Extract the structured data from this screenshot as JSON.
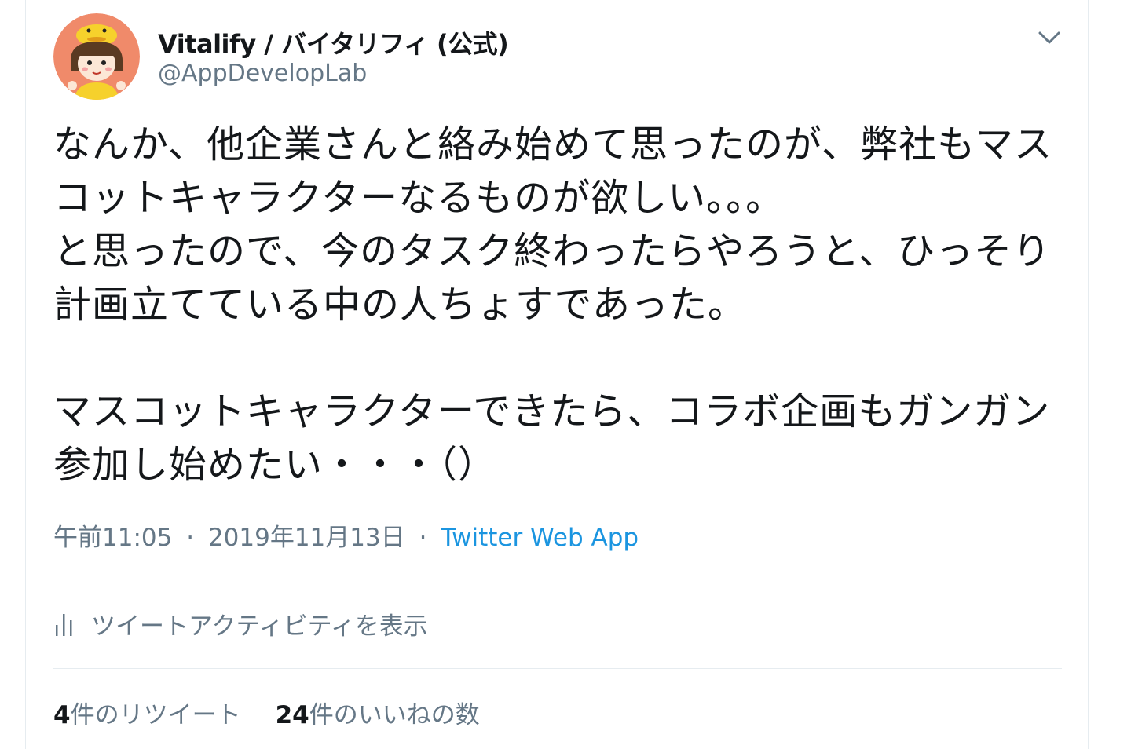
{
  "author": {
    "display_name": "Vitalify / バイタリフィ (公式)",
    "handle": "@AppDevelopLab",
    "avatar_icon": "mascot-avatar-icon"
  },
  "tweet": {
    "paragraph1": "なんか、他企業さんと絡み始めて思ったのが、弊社もマスコットキャラクターなるものが欲しい。。。\nと思ったので、今のタスク終わったらやろうと、ひっそり計画立てている中の人ちょすであった。",
    "paragraph2": "マスコットキャラクターできたら、コラボ企画もガンガン参加し始めたい・・・（）"
  },
  "meta": {
    "time": "午前11:05",
    "separator": "·",
    "date": "2019年11月13日",
    "source": "Twitter Web App"
  },
  "activity": {
    "label": "ツイートアクティビティを表示",
    "icon": "bar-chart-icon"
  },
  "stats": {
    "retweet_count": "4",
    "retweet_label": "件のリツイート",
    "like_count": "24",
    "like_label": "件のいいねの数"
  },
  "colors": {
    "text": "#14171a",
    "secondary": "#657786",
    "link": "#1b95e0",
    "border": "#e6ecf0"
  }
}
